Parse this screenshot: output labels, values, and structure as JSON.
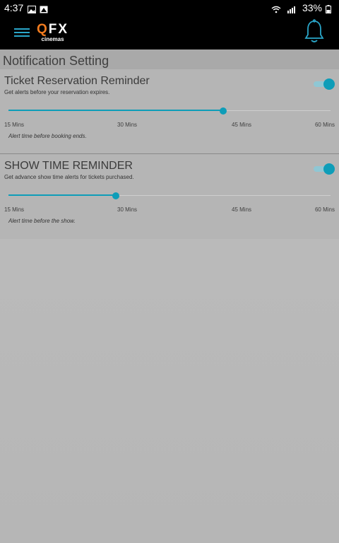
{
  "status_bar": {
    "time": "4:37",
    "battery": "33%",
    "icons": [
      "image-icon",
      "photo-icon",
      "wifi-icon",
      "signal-icon",
      "battery-icon"
    ]
  },
  "app_bar": {
    "logo_main": "QFX",
    "logo_sub": "cinemas",
    "menu_icon": "hamburger-icon",
    "bell_icon": "bell-icon",
    "accent": "#2aa6c9",
    "logo_accent": "#f07b1f"
  },
  "page": {
    "title": "Notification Setting"
  },
  "sections": [
    {
      "title": "Ticket Reservation Reminder",
      "description": "Get alerts before your reservation expires.",
      "enabled": true,
      "slider_fraction": 0.666,
      "ticks": [
        "15 Mins",
        "30 Mins",
        "45 Mins",
        "60 Mins"
      ],
      "hint": "Alert time before booking ends."
    },
    {
      "title": "SHOW TIME REMINDER",
      "description": "Get advance show time alerts for tickets purchased.",
      "enabled": true,
      "slider_fraction": 0.333,
      "ticks": [
        "15 Mins",
        "30 Mins",
        "45 Mins",
        "60 Mins"
      ],
      "hint": "Alert time before the show."
    }
  ],
  "colors": {
    "toggle_on": "#0e9db8",
    "slider_fill": "#0e9db8"
  }
}
